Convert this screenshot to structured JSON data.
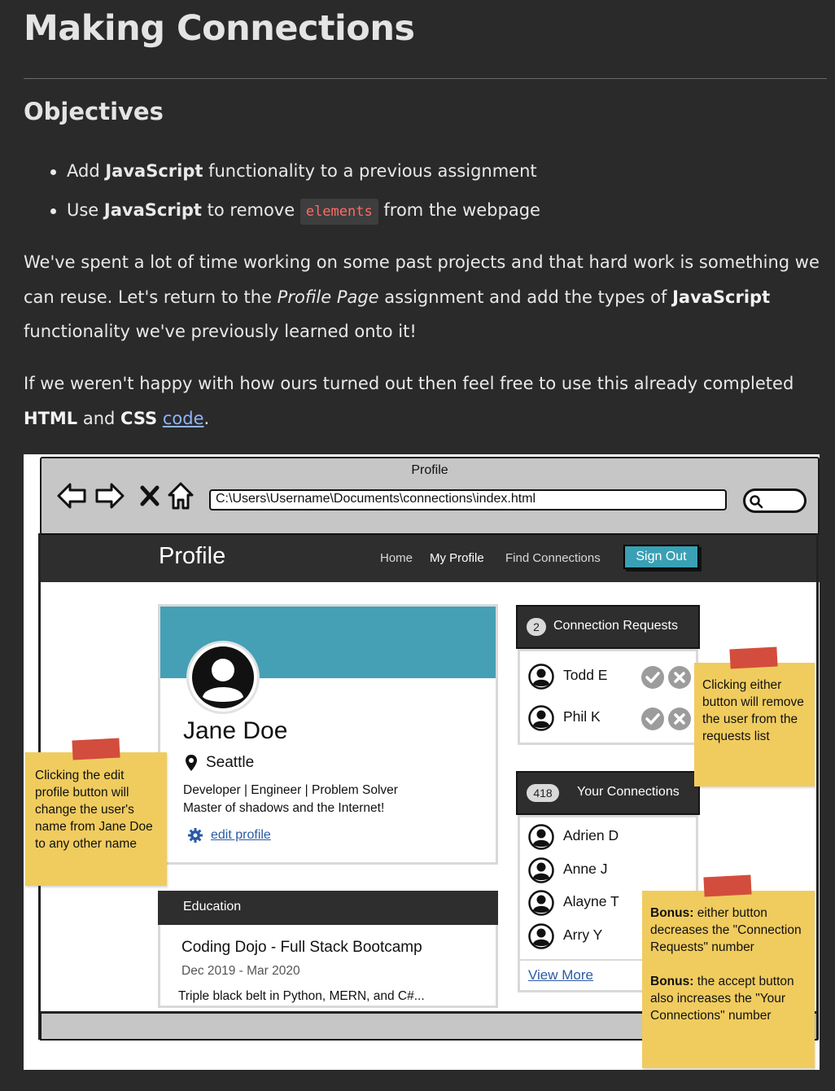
{
  "lesson": {
    "title": "Making Connections",
    "objectives_heading": "Objectives",
    "objectives": [
      {
        "pre": "Add ",
        "bold": "JavaScript",
        "post": " functionality to a previous assignment"
      },
      {
        "pre": "Use ",
        "bold": "JavaScript",
        "mid": " to remove ",
        "code": "elements",
        "post": " from the webpage"
      }
    ],
    "para1": {
      "a": "We've spent a lot of time working on some past projects and that hard work is something we can reuse. Let's return to the ",
      "em": "Profile Page",
      "b": " assignment and add the types of ",
      "bold": "JavaScript",
      "c": " functionality we've previously learned onto it!"
    },
    "para2": {
      "a": "If we weren't happy with how ours turned out then feel free to use this already completed ",
      "bold1": "HTML",
      "b": " and ",
      "bold2": "CSS",
      "link": "code",
      "c": "."
    }
  },
  "wireframe": {
    "browser_title": "Profile",
    "url": "C:\\Users\\Username\\Documents\\connections\\index.html",
    "nav": {
      "brand": "Profile",
      "links": [
        "Home",
        "My Profile",
        "Find Connections"
      ],
      "signout": "Sign Out"
    },
    "profile": {
      "name": "Jane Doe",
      "location": "Seattle",
      "bio_line1": "Developer | Engineer | Problem Solver",
      "bio_line2": "Master of shadows and the Internet!",
      "edit": "edit profile"
    },
    "education": {
      "heading": "Education",
      "school": "Coding Dojo - Full Stack Bootcamp",
      "dates": "Dec 2019 - Mar 2020",
      "description": "Triple black belt in Python, MERN, and C#..."
    },
    "requests": {
      "count": "2",
      "heading": "Connection Requests",
      "people": [
        "Todd E",
        "Phil K"
      ]
    },
    "connections": {
      "count": "418",
      "heading": "Your Connections",
      "people": [
        "Adrien D",
        "Anne J",
        "Alayne T",
        "Arry Y"
      ],
      "view_more": "View More"
    },
    "notes": {
      "left": "Clicking the edit profile button will change the user's name from Jane Doe to any other name",
      "right_top": "Clicking either button will remove the user from the requests list",
      "bonus1_label": "Bonus:",
      "bonus1_text": " either button decreases the \"Connection Requests\" number",
      "bonus2_label": "Bonus:",
      "bonus2_text": " the accept button also increases the \"Your Connections\" number"
    }
  },
  "colors": {
    "page_bg": "#2a2a2a",
    "accent_teal": "#45a0b5",
    "note_yellow": "#f0cc5f",
    "tape_red": "#d24d3d",
    "code_red": "#ff6a63",
    "link_blue": "#8fb3ff"
  }
}
